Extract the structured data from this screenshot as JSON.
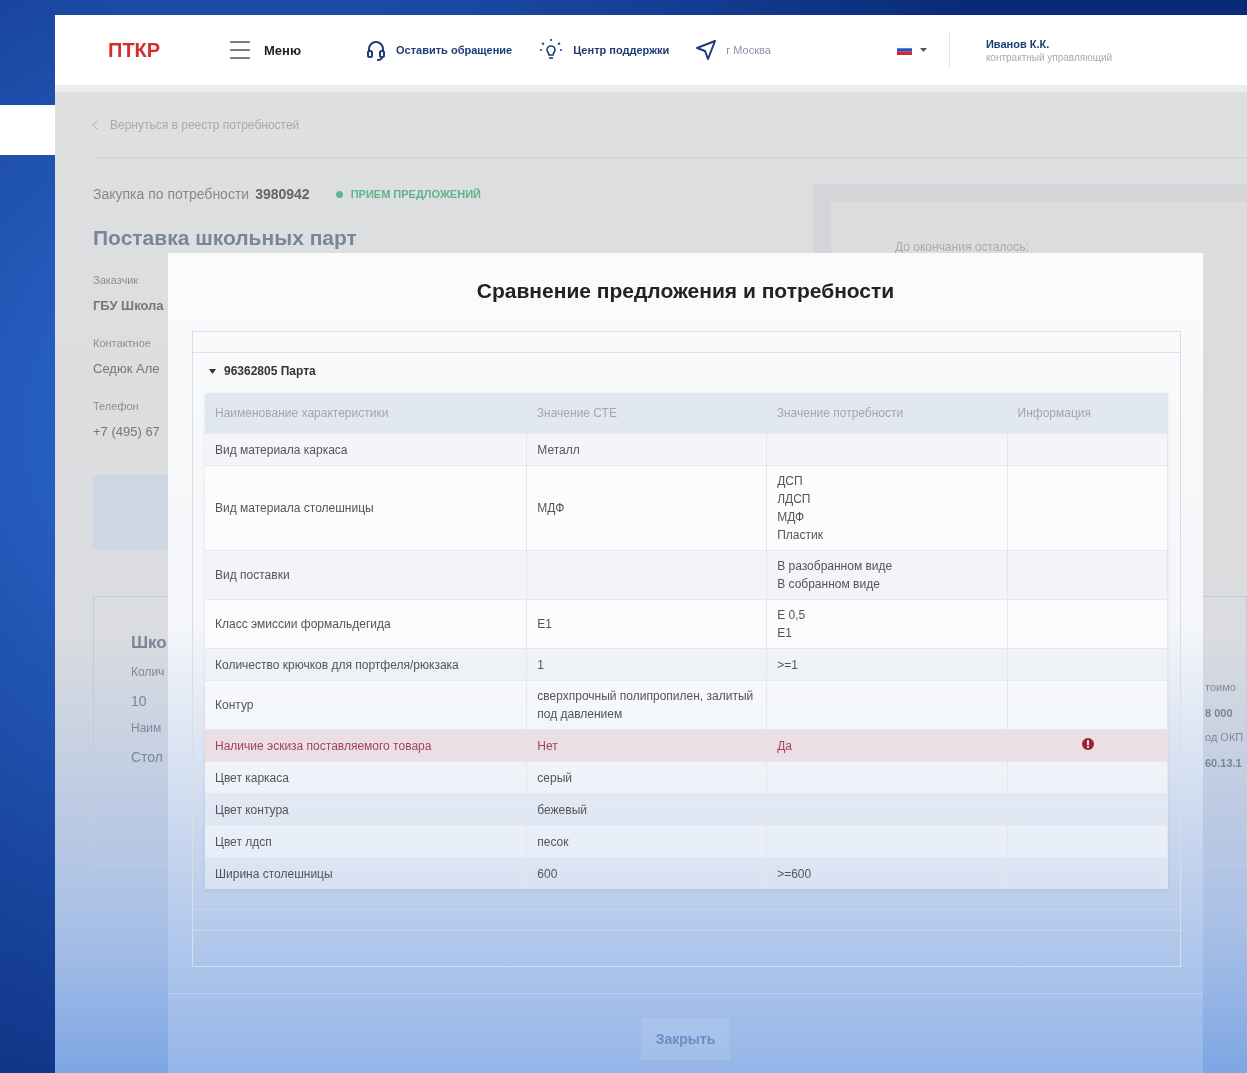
{
  "header": {
    "logo": "ПТКР",
    "menu": "Меню",
    "links": [
      {
        "kind": "headset",
        "label": "Оставить обращение"
      },
      {
        "kind": "bulb",
        "label": "Центр поддержки"
      },
      {
        "kind": "location",
        "label": "г Москва"
      }
    ],
    "user": {
      "name": "Иванов К.К.",
      "role": "контрактный управляющий"
    }
  },
  "page": {
    "back_link": "Вернуться в реестр потребностей",
    "purchase_label": "Закупка по потребности",
    "purchase_number": "3980942",
    "status": "ПРИЕМ ПРЕДЛОЖЕНИЙ",
    "title": "Поставка школьных парт",
    "fields": [
      {
        "label": "Заказчик",
        "value": "ГБУ Школа"
      },
      {
        "label": "Контактное",
        "value": "Седюк Але"
      },
      {
        "label": "Телефон",
        "value": "+7 (495) 67"
      }
    ],
    "deadline_label": "До окончания осталось:",
    "item": {
      "name": "Шко",
      "left": [
        {
          "label": "Колич",
          "value": "10"
        },
        {
          "label": "Наим",
          "value": "Стол"
        }
      ],
      "right": [
        {
          "label": "тоимо",
          "value": "8 000"
        },
        {
          "label": "од ОКП",
          "value": "60.13.1"
        }
      ]
    }
  },
  "modal": {
    "title": "Сравнение предложения и потребности",
    "columns": [
      "Наименование характеристики",
      "Значение СТЕ",
      "Значение потребности",
      "Информация"
    ],
    "groups": [
      {
        "title": "96362805 Парта",
        "expanded": true,
        "rows": [
          {
            "name": "Вид материала каркаса",
            "ste": "Металл",
            "need": [],
            "mismatch": false
          },
          {
            "name": "Вид материала столешницы",
            "ste": "МДФ",
            "need": [
              "ДСП",
              "ЛДСП",
              "МДФ",
              "Пластик"
            ],
            "mismatch": false
          },
          {
            "name": "Вид поставки",
            "ste": "",
            "need": [
              "В разобранном виде",
              "В собранном виде"
            ],
            "mismatch": false
          },
          {
            "name": "Класс эмиссии формальдегида",
            "ste": "Е1",
            "need": [
              "Е 0,5",
              "Е1"
            ],
            "mismatch": false
          },
          {
            "name": "Количество крючков для портфеля/рюкзака",
            "ste": "1",
            "need": [
              ">=1"
            ],
            "mismatch": false
          },
          {
            "name": "Контур",
            "ste": "сверхпрочный полипропилен, залитый под давлением",
            "need": [],
            "mismatch": false
          },
          {
            "name": "Наличие эскиза поставляемого товара",
            "ste": "Нет",
            "need": [
              "Да"
            ],
            "mismatch": true
          },
          {
            "name": "Цвет каркаса",
            "ste": "серый",
            "need": [],
            "mismatch": false
          },
          {
            "name": "Цвет контура",
            "ste": "бежевый",
            "need": [],
            "mismatch": false
          },
          {
            "name": "Цвет лдсп",
            "ste": "песок",
            "need": [],
            "mismatch": false
          },
          {
            "name": "Ширина столешницы",
            "ste": "600",
            "need": [
              ">=600"
            ],
            "mismatch": false
          }
        ]
      }
    ],
    "close_button": "Закрыть"
  }
}
